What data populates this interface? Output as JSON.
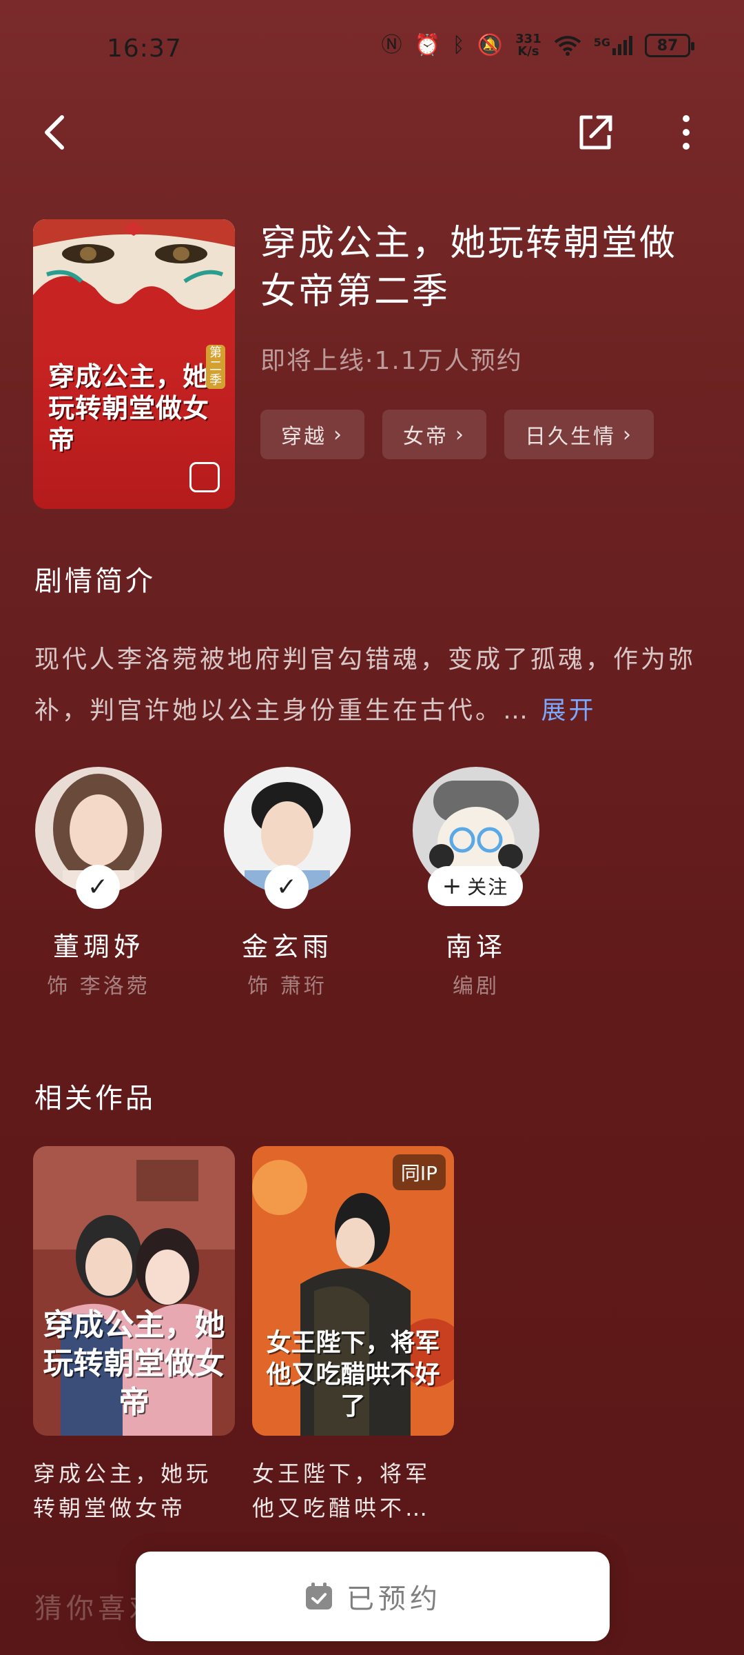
{
  "status_bar": {
    "time": "16:37",
    "net_speed_value": "331",
    "net_speed_unit": "K/s",
    "network": "5G",
    "battery": "87",
    "icons": [
      "nfc-icon",
      "alarm-icon",
      "bluetooth-icon",
      "mute-icon",
      "wifi-icon",
      "signal-icon"
    ]
  },
  "header": {
    "back_icon": "back-icon",
    "share_icon": "share-icon",
    "more_icon": "more-icon"
  },
  "drama": {
    "title": "穿成公主，她玩转朝堂做女帝第二季",
    "status": "即将上线·1.1万人预约",
    "cover_text": "穿成公主，她玩转朝堂做女帝",
    "cover_badge": "第二季",
    "tags": [
      {
        "label": "穿越"
      },
      {
        "label": "女帝"
      },
      {
        "label": "日久生情"
      }
    ]
  },
  "synopsis": {
    "heading": "剧情简介",
    "text": "现代人李洛菀被地府判官勾错魂，变成了孤魂，作为弥补，判官许她以公主身份重生在古代。…",
    "expand_label": "展开"
  },
  "cast": [
    {
      "name": "董琱妤",
      "role": "饰 李洛菀",
      "followed": true
    },
    {
      "name": "金玄雨",
      "role": "饰 萧珩",
      "followed": true
    },
    {
      "name": "南译",
      "role": "编剧",
      "followed": false,
      "follow_label": "关注"
    }
  ],
  "related": {
    "heading": "相关作品",
    "items": [
      {
        "title": "穿成公主，她玩转朝堂做女帝",
        "poster_text": "穿成公主，她玩转朝堂做女帝"
      },
      {
        "title": "女王陛下，将军他又吃醋哄不…",
        "poster_text": "女王陛下，将军他又吃醋哄不好了",
        "badge": "同IP"
      }
    ]
  },
  "next_section_partial": "猜你喜欢",
  "cta": {
    "label": "已预约",
    "icon": "calendar-check-icon"
  }
}
